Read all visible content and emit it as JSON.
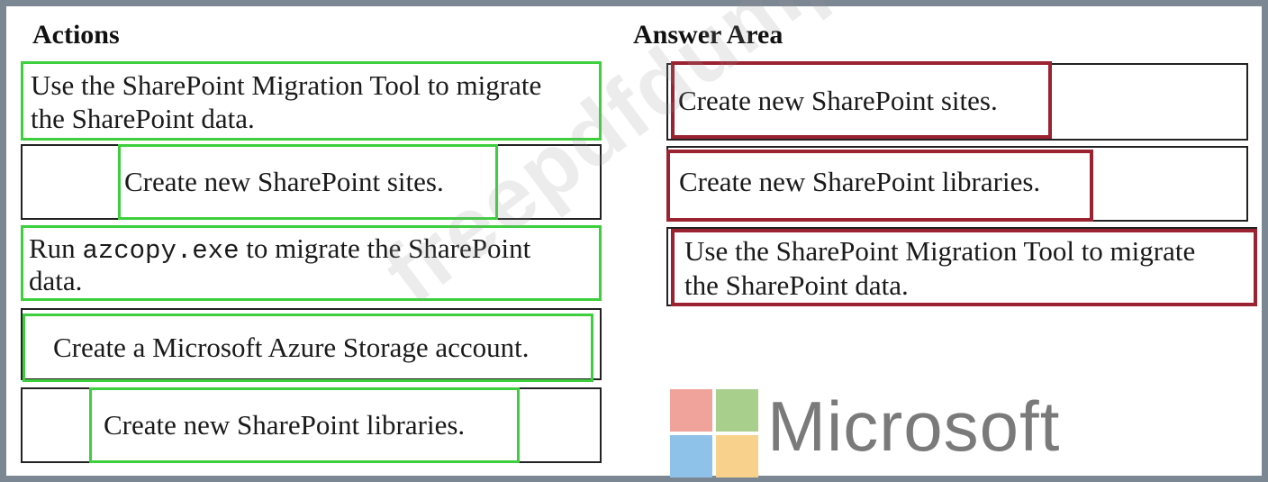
{
  "actions": {
    "heading": "Actions",
    "items": [
      {
        "line1": "Use the SharePoint Migration Tool to migrate",
        "line2": "the SharePoint data."
      },
      {
        "line1": "Create new SharePoint sites."
      },
      {
        "line1_prefix": "Run ",
        "line1_code": "azcopy.exe",
        "line1_suffix": " to migrate the SharePoint",
        "line2": "data."
      },
      {
        "line1": "Create a Microsoft Azure Storage account."
      },
      {
        "line1": "Create new SharePoint libraries."
      }
    ]
  },
  "answer_area": {
    "heading": "Answer Area",
    "items": [
      {
        "line1": "Create new SharePoint sites."
      },
      {
        "line1": "Create new SharePoint libraries."
      },
      {
        "line1": "Use the SharePoint Migration Tool to migrate",
        "line2": "the SharePoint data."
      }
    ]
  },
  "watermark": "freepdfdumps.com",
  "logo": {
    "wordmark": "Microsoft",
    "colors": [
      "#f0a39a",
      "#a9cf8c",
      "#8fc2e8",
      "#f8d28c"
    ]
  },
  "colors": {
    "selected_outline": "#3ecf3e",
    "answer_outline": "#9b2230"
  }
}
